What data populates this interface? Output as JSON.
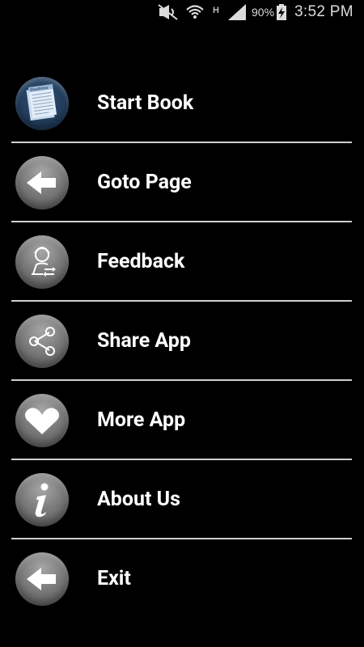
{
  "status_bar": {
    "battery_percent": "90%",
    "time": "3:52 PM",
    "icons": [
      "mute-icon",
      "wifi-icon",
      "hspa-icon",
      "signal-icon",
      "battery-charging-icon"
    ]
  },
  "menu": {
    "items": [
      {
        "label": "Start Book",
        "icon": "book-pages-icon"
      },
      {
        "label": "Goto Page",
        "icon": "arrow-left-icon"
      },
      {
        "label": "Feedback",
        "icon": "feedback-person-icon"
      },
      {
        "label": "Share App",
        "icon": "share-icon"
      },
      {
        "label": "More App",
        "icon": "heart-icon"
      },
      {
        "label": "About Us",
        "icon": "info-icon"
      },
      {
        "label": "Exit",
        "icon": "arrow-left-icon"
      }
    ]
  },
  "colors": {
    "background": "#000000",
    "text": "#ffffff",
    "divider": "#cfcfcf",
    "icon_circle": "#7c7c7c",
    "book_icon_bg": "#1b3350"
  }
}
